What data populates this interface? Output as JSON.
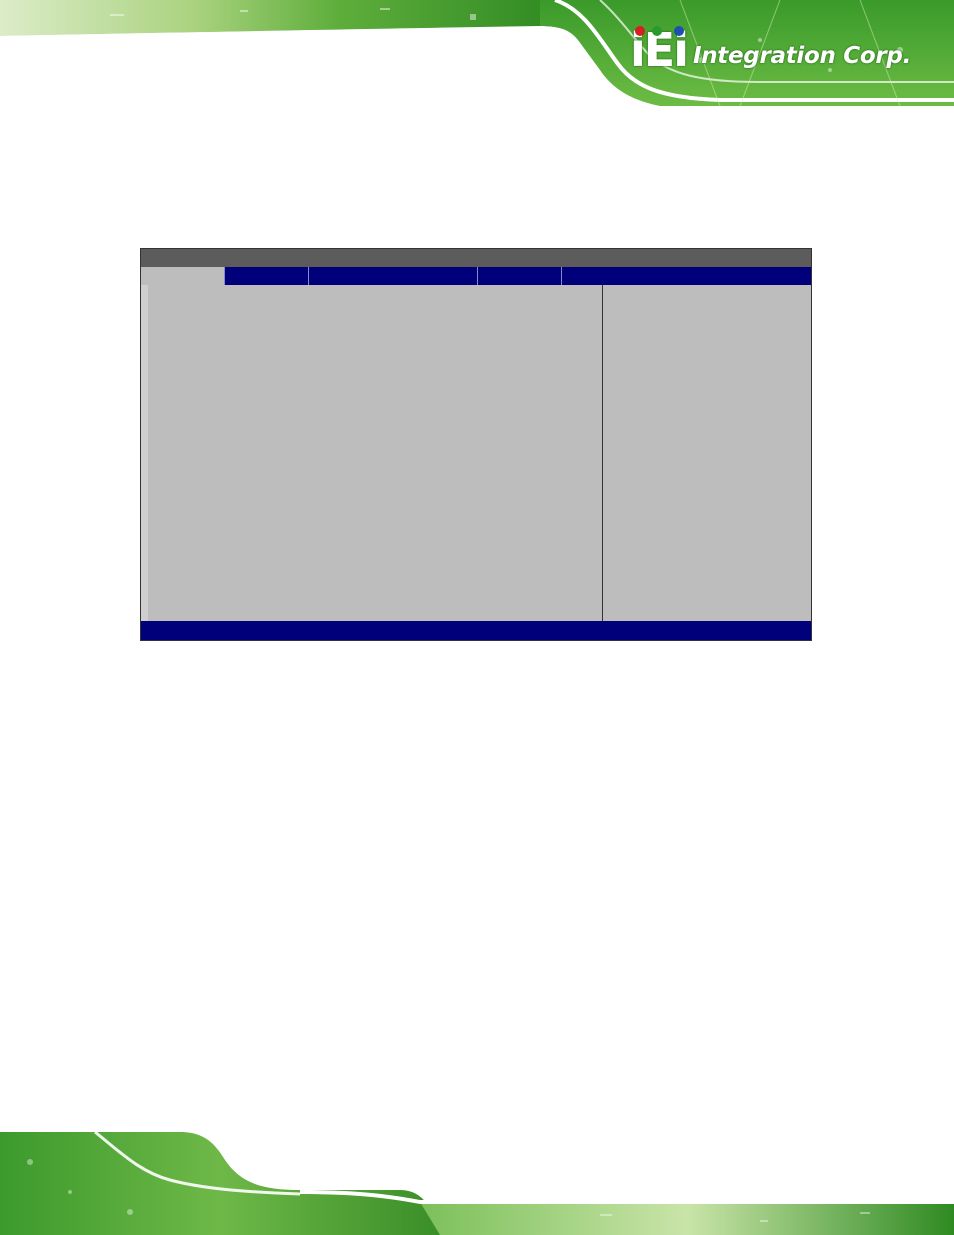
{
  "brand": {
    "logo_mark": "iEi",
    "logo_text": "Integration Corp.",
    "colors": {
      "green": "#3f9a2a",
      "light_green": "#b5d88a",
      "navy": "#00007a",
      "gray": "#bdbdbd",
      "red_dot": "#d42020",
      "green_dot": "#2a9a2a",
      "blue_dot": "#1f4fb0"
    }
  },
  "bios": {
    "title": "",
    "menu_tabs": [
      {
        "label": "",
        "active": true
      },
      {
        "label": "",
        "active": false
      },
      {
        "label": "",
        "active": false
      },
      {
        "label": "",
        "active": false
      },
      {
        "label": "",
        "active": false
      }
    ],
    "main_items": [],
    "help_text": "",
    "status_bar": ""
  }
}
